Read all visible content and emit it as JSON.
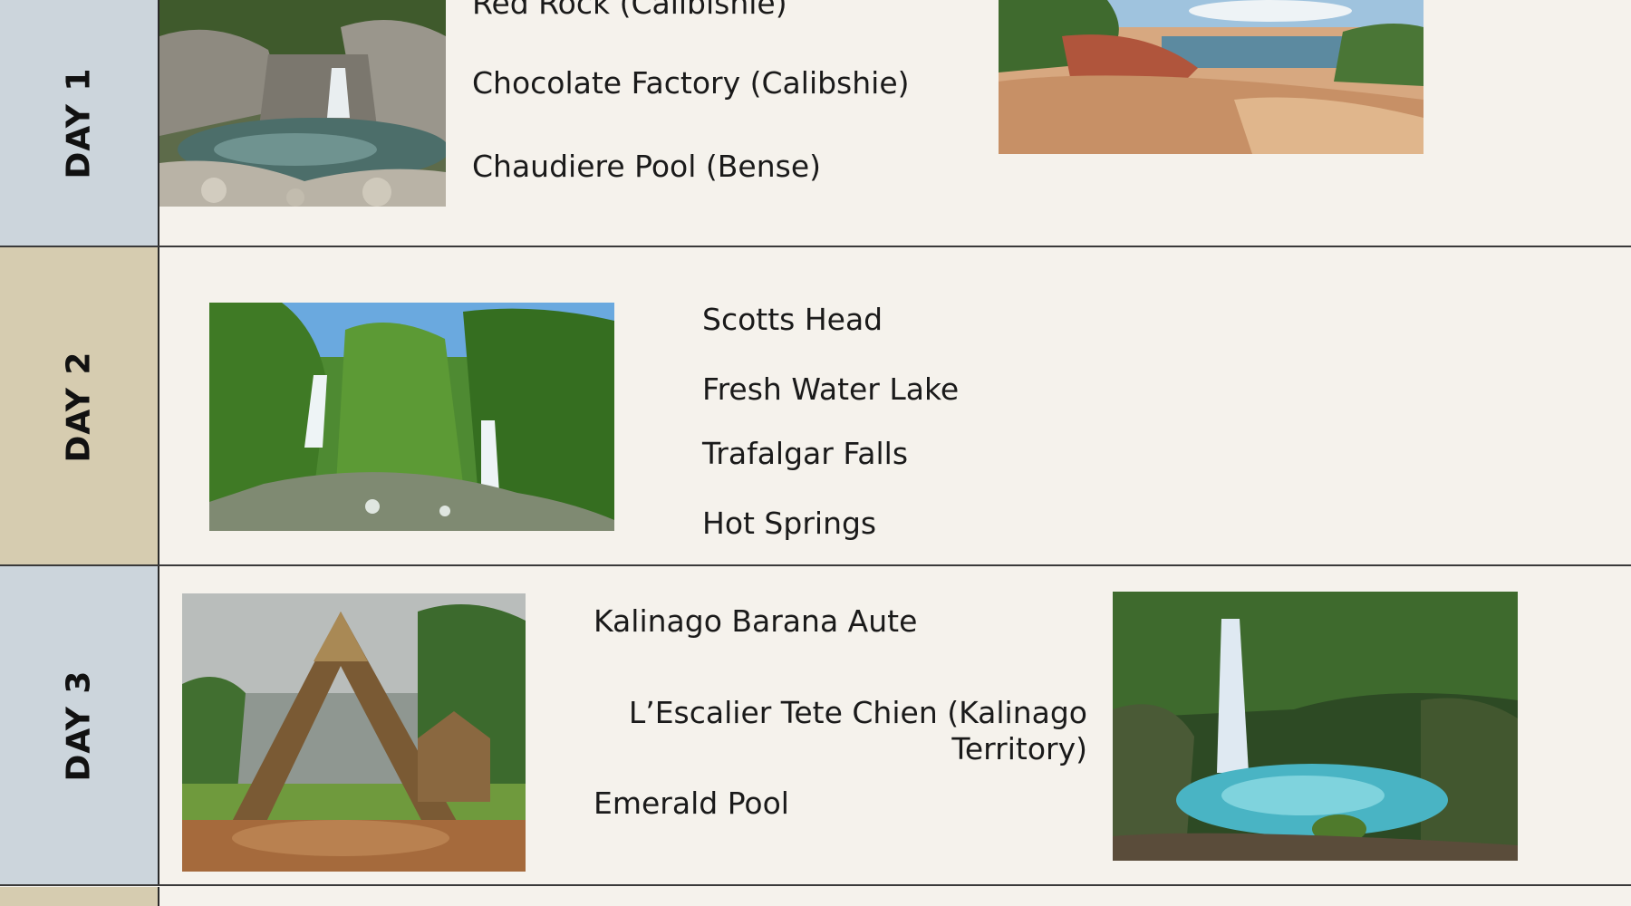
{
  "colors": {
    "background": "#f5f2ec",
    "day_blue": "#ccd5dc",
    "day_tan": "#d6ccb0",
    "divider": "#3a3a3a"
  },
  "days": [
    {
      "label": "DAY 1",
      "items": [
        "Red Rock (Calibishie)",
        "Chocolate Factory (Calibshie)",
        "Chaudiere Pool (Bense)"
      ],
      "photos": [
        "river-waterfall-photo",
        "red-rock-coast-photo"
      ]
    },
    {
      "label": "DAY 2",
      "items": [
        "Scotts Head",
        "Fresh Water Lake",
        "Trafalgar Falls",
        "Hot Springs"
      ],
      "photos": [
        "twin-waterfalls-photo"
      ]
    },
    {
      "label": "DAY 3",
      "items": [
        "Kalinago Barana Aute",
        "L’Escalier Tete Chien (Kalinago Territory)",
        "Emerald Pool"
      ],
      "photos": [
        "thatched-hut-photo",
        "emerald-pool-photo"
      ]
    }
  ]
}
